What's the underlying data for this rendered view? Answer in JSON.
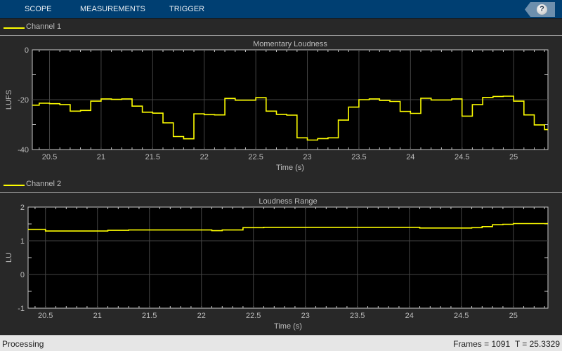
{
  "toolbar": {
    "tabs": [
      "SCOPE",
      "MEASUREMENTS",
      "TRIGGER"
    ],
    "help_label": "?"
  },
  "status": {
    "left": "Processing",
    "frames": "Frames = 1091",
    "time": "T = 25.3329"
  },
  "colors": {
    "trace": "#ffff00",
    "toolbar": "#003f72"
  },
  "chart_data": [
    {
      "type": "line",
      "legend": "Channel 1",
      "title": "Momentary Loudness",
      "xlabel": "Time (s)",
      "ylabel": "LUFS",
      "xlim": [
        20.333,
        25.3329
      ],
      "ylim": [
        -40,
        0
      ],
      "xticks": [
        20.5,
        21,
        21.5,
        22,
        22.5,
        23,
        23.5,
        24,
        24.5,
        25
      ],
      "xtick_labels": [
        "20.5",
        "21",
        "21.5",
        "22",
        "22.5",
        "23",
        "23.5",
        "24",
        "24.5",
        "25"
      ],
      "yticks": [
        0,
        -20,
        -40
      ],
      "ytick_labels": [
        "0",
        "-20",
        "-40"
      ],
      "grid": true,
      "step_starts": [
        20.333,
        20.4,
        20.5,
        20.6,
        20.7,
        20.8,
        20.9,
        21.0,
        21.1,
        21.2,
        21.3,
        21.4,
        21.5,
        21.6,
        21.7,
        21.8,
        21.9,
        22.0,
        22.1,
        22.2,
        22.3,
        22.4,
        22.5,
        22.6,
        22.7,
        22.8,
        22.9,
        23.0,
        23.1,
        23.2,
        23.3,
        23.4,
        23.5,
        23.6,
        23.7,
        23.8,
        23.9,
        24.0,
        24.1,
        24.2,
        24.3,
        24.4,
        24.5,
        24.6,
        24.7,
        24.8,
        24.9,
        25.0,
        25.1,
        25.2,
        25.3
      ],
      "values": [
        -22.2,
        -21.4,
        -21.6,
        -22.0,
        -24.6,
        -24.3,
        -20.6,
        -19.7,
        -19.9,
        -19.7,
        -22.6,
        -25.0,
        -25.4,
        -29.3,
        -34.8,
        -35.7,
        -25.7,
        -26.0,
        -26.1,
        -19.5,
        -20.2,
        -20.2,
        -19.2,
        -24.6,
        -25.9,
        -26.2,
        -35.3,
        -36.2,
        -35.6,
        -35.3,
        -28.2,
        -23.0,
        -20.0,
        -19.7,
        -20.3,
        -20.7,
        -24.7,
        -25.5,
        -19.4,
        -20.1,
        -20.1,
        -19.7,
        -26.6,
        -22.0,
        -19.1,
        -18.7,
        -18.6,
        -20.6,
        -26.1,
        -30.1,
        -32.0
      ]
    },
    {
      "type": "line",
      "legend": "Channel 2",
      "title": "Loudness Range",
      "xlabel": "Time (s)",
      "ylabel": "LU",
      "xlim": [
        20.333,
        25.3329
      ],
      "ylim": [
        -1,
        2
      ],
      "xticks": [
        20.5,
        21,
        21.5,
        22,
        22.5,
        23,
        23.5,
        24,
        24.5,
        25
      ],
      "xtick_labels": [
        "20.5",
        "21",
        "21.5",
        "22",
        "22.5",
        "23",
        "23.5",
        "24",
        "24.5",
        "25"
      ],
      "yticks": [
        2,
        1,
        0,
        -1
      ],
      "ytick_labels": [
        "2",
        "1",
        "0",
        "-1"
      ],
      "grid": true,
      "step_starts": [
        20.333,
        20.5,
        21.1,
        21.3,
        22.1,
        22.2,
        22.4,
        22.6,
        24.1,
        24.6,
        24.7,
        24.8,
        24.9,
        25.0
      ],
      "values": [
        1.34,
        1.29,
        1.31,
        1.32,
        1.3,
        1.32,
        1.39,
        1.4,
        1.38,
        1.39,
        1.42,
        1.48,
        1.49,
        1.51
      ]
    }
  ]
}
